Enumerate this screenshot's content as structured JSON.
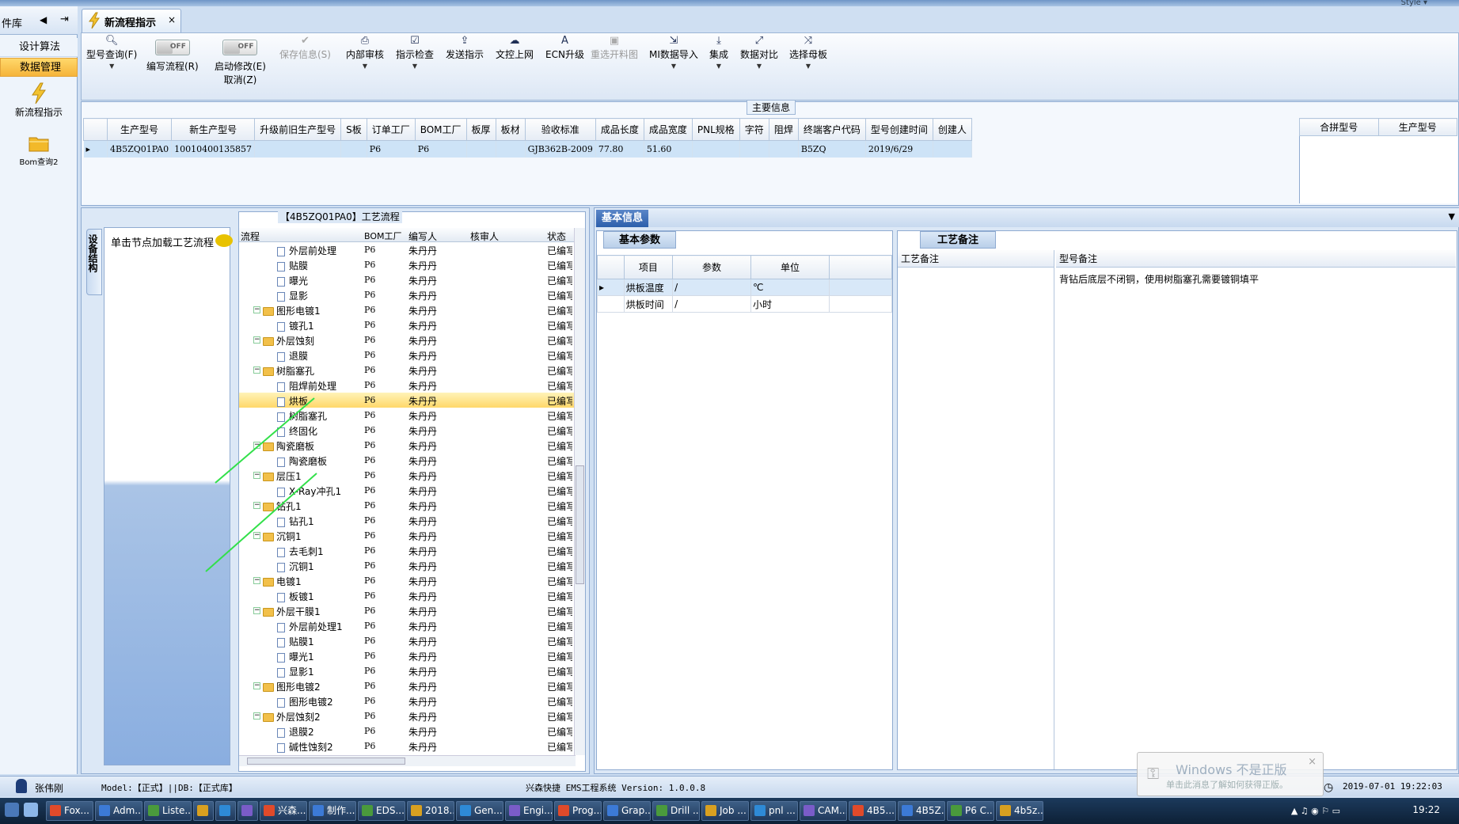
{
  "app": {
    "style_label": "Style ▾"
  },
  "leftnav": {
    "title": "件库",
    "items": [
      {
        "label": "设计算法"
      },
      {
        "label": "数据管理"
      }
    ],
    "tiles": [
      {
        "label": "新流程指示",
        "icon": "lightning-icon"
      },
      {
        "label": "Bom查询2",
        "icon": "folder-icon"
      }
    ]
  },
  "doc_tab": {
    "title": "新流程指示",
    "close": "×"
  },
  "toolbar": {
    "items": [
      {
        "label": "型号查询(F)",
        "icon": "search-icon"
      },
      {
        "label": "编写流程(R)",
        "toggle": "OFF"
      },
      {
        "label": "启动修改(E)",
        "label2": "取消(Z)",
        "toggle": "OFF"
      },
      {
        "label": "保存信息(S)",
        "icon": "check-icon"
      },
      {
        "label": "内部审核",
        "icon": "printer-icon"
      },
      {
        "label": "指示检查",
        "icon": "checklist-icon"
      },
      {
        "label": "发送指示",
        "icon": "upload-icon"
      },
      {
        "label": "文控上网",
        "icon": "cloud-upload-icon"
      },
      {
        "label": "ECN升级",
        "icon": "font-icon"
      },
      {
        "label": "重选开料图",
        "icon": "image-icon"
      },
      {
        "label": "MI数据导入",
        "icon": "import-icon"
      },
      {
        "label": "集成",
        "icon": "download-icon"
      },
      {
        "label": "数据对比",
        "icon": "compare-icon"
      },
      {
        "label": "选择母板",
        "icon": "shuffle-icon"
      }
    ]
  },
  "main_info": {
    "title": "主要信息",
    "columns": [
      "生产型号",
      "新生产型号",
      "升级前旧生产型号",
      "S板",
      "订单工厂",
      "BOM工厂",
      "板厚",
      "板材",
      "验收标准",
      "成品长度",
      "成品宽度",
      "PNL规格",
      "字符",
      "阻焊",
      "终端客户代码",
      "型号创建时间",
      "创建人"
    ],
    "row": [
      "4B5ZQ01PA0",
      "10010400135857",
      "",
      "",
      "P6",
      "P6",
      "",
      "",
      "GJB362B-2009",
      "77.80",
      "51.60",
      "",
      "",
      "",
      "B5ZQ",
      "2019/6/29",
      ""
    ],
    "merge_columns": [
      "合拼型号",
      "生产型号"
    ]
  },
  "side_tab": {
    "label": "设备结构"
  },
  "load_hint": "单击节点加载工艺流程",
  "flow": {
    "caption": "【4B5ZQ01PA0】工艺流程",
    "headers": {
      "flow": "流程",
      "bom": "BOM工厂",
      "author": "编写人",
      "reviewer": "核审人",
      "status": "状态"
    },
    "rows": [
      {
        "name": "外层前处理",
        "level": 2,
        "bom": "P6",
        "author": "朱丹丹",
        "status": "已编写"
      },
      {
        "name": "贴膜",
        "level": 2,
        "bom": "P6",
        "author": "朱丹丹",
        "status": "已编写"
      },
      {
        "name": "曝光",
        "level": 2,
        "bom": "P6",
        "author": "朱丹丹",
        "status": "已编写"
      },
      {
        "name": "显影",
        "level": 2,
        "bom": "P6",
        "author": "朱丹丹",
        "status": "已编写"
      },
      {
        "name": "图形电镀1",
        "level": 1,
        "bom": "P6",
        "author": "朱丹丹",
        "status": "已编写"
      },
      {
        "name": "镀孔1",
        "level": 2,
        "bom": "P6",
        "author": "朱丹丹",
        "status": "已编写"
      },
      {
        "name": "外层蚀刻",
        "level": 1,
        "bom": "P6",
        "author": "朱丹丹",
        "status": "已编写"
      },
      {
        "name": "退膜",
        "level": 2,
        "bom": "P6",
        "author": "朱丹丹",
        "status": "已编写"
      },
      {
        "name": "树脂塞孔",
        "level": 1,
        "bom": "P6",
        "author": "朱丹丹",
        "status": "已编写"
      },
      {
        "name": "阻焊前处理",
        "level": 2,
        "bom": "P6",
        "author": "朱丹丹",
        "status": "已编写"
      },
      {
        "name": "烘板",
        "level": 2,
        "bom": "P6",
        "author": "朱丹丹",
        "status": "已编写",
        "selected": true
      },
      {
        "name": "树脂塞孔",
        "level": 2,
        "bom": "P6",
        "author": "朱丹丹",
        "status": "已编写"
      },
      {
        "name": "终固化",
        "level": 2,
        "bom": "P6",
        "author": "朱丹丹",
        "status": "已编写"
      },
      {
        "name": "陶瓷磨板",
        "level": 1,
        "bom": "P6",
        "author": "朱丹丹",
        "status": "已编写"
      },
      {
        "name": "陶瓷磨板",
        "level": 2,
        "bom": "P6",
        "author": "朱丹丹",
        "status": "已编写"
      },
      {
        "name": "层压1",
        "level": 1,
        "bom": "P6",
        "author": "朱丹丹",
        "status": "已编写"
      },
      {
        "name": "X-Ray冲孔1",
        "level": 2,
        "bom": "P6",
        "author": "朱丹丹",
        "status": "已编写"
      },
      {
        "name": "钻孔1",
        "level": 1,
        "bom": "P6",
        "author": "朱丹丹",
        "status": "已编写"
      },
      {
        "name": "钻孔1",
        "level": 2,
        "bom": "P6",
        "author": "朱丹丹",
        "status": "已编写"
      },
      {
        "name": "沉铜1",
        "level": 1,
        "bom": "P6",
        "author": "朱丹丹",
        "status": "已编写"
      },
      {
        "name": "去毛刺1",
        "level": 2,
        "bom": "P6",
        "author": "朱丹丹",
        "status": "已编写"
      },
      {
        "name": "沉铜1",
        "level": 2,
        "bom": "P6",
        "author": "朱丹丹",
        "status": "已编写"
      },
      {
        "name": "电镀1",
        "level": 1,
        "bom": "P6",
        "author": "朱丹丹",
        "status": "已编写"
      },
      {
        "name": "板镀1",
        "level": 2,
        "bom": "P6",
        "author": "朱丹丹",
        "status": "已编写"
      },
      {
        "name": "外层干膜1",
        "level": 1,
        "bom": "P6",
        "author": "朱丹丹",
        "status": "已编写"
      },
      {
        "name": "外层前处理1",
        "level": 2,
        "bom": "P6",
        "author": "朱丹丹",
        "status": "已编写"
      },
      {
        "name": "贴膜1",
        "level": 2,
        "bom": "P6",
        "author": "朱丹丹",
        "status": "已编写"
      },
      {
        "name": "曝光1",
        "level": 2,
        "bom": "P6",
        "author": "朱丹丹",
        "status": "已编写"
      },
      {
        "name": "显影1",
        "level": 2,
        "bom": "P6",
        "author": "朱丹丹",
        "status": "已编写"
      },
      {
        "name": "图形电镀2",
        "level": 1,
        "bom": "P6",
        "author": "朱丹丹",
        "status": "已编写"
      },
      {
        "name": "图形电镀2",
        "level": 2,
        "bom": "P6",
        "author": "朱丹丹",
        "status": "已编写"
      },
      {
        "name": "外层蚀刻2",
        "level": 1,
        "bom": "P6",
        "author": "朱丹丹",
        "status": "已编写"
      },
      {
        "name": "退膜2",
        "level": 2,
        "bom": "P6",
        "author": "朱丹丹",
        "status": "已编写"
      },
      {
        "name": "碱性蚀刻2",
        "level": 2,
        "bom": "P6",
        "author": "朱丹丹",
        "status": "已编写"
      }
    ]
  },
  "right": {
    "tab": "基本信息",
    "params_tab": "基本参数",
    "params_headers": [
      "项目",
      "参数",
      "单位"
    ],
    "params": [
      {
        "item": "烘板温度",
        "value": "/",
        "unit": "℃"
      },
      {
        "item": "烘板时间",
        "value": "/",
        "unit": "小时"
      }
    ],
    "notes_tab": "工艺备注",
    "notes_headers": [
      "工艺备注",
      "型号备注"
    ],
    "model_note": "背钻后底层不闭铜，使用树脂塞孔需要镀铜填平"
  },
  "status": {
    "user": "张伟刚",
    "model": "Model:【正式】||DB:【正式库】",
    "system": "兴森快捷 EMS工程系统 Version: 1.0.0.8",
    "datetime": "2019-07-01 19:22:03"
  },
  "notification": {
    "title": "Windows 不是正版",
    "subtitle": "单击此消息了解如何获得正版。"
  },
  "taskbar": {
    "tasks": [
      "Fox...",
      "Adm...",
      "Liste...",
      "",
      "",
      "",
      "兴森...",
      "制作...",
      "EDS...",
      "2018...",
      "Gen...",
      "Engi...",
      "Prog...",
      "Grap...",
      "Drill ...",
      "Job ...",
      "pnl ...",
      "CAM...",
      "4B5...",
      "4B5Z...",
      "P6 C...",
      "4b5z..."
    ],
    "clock": "19:22"
  }
}
